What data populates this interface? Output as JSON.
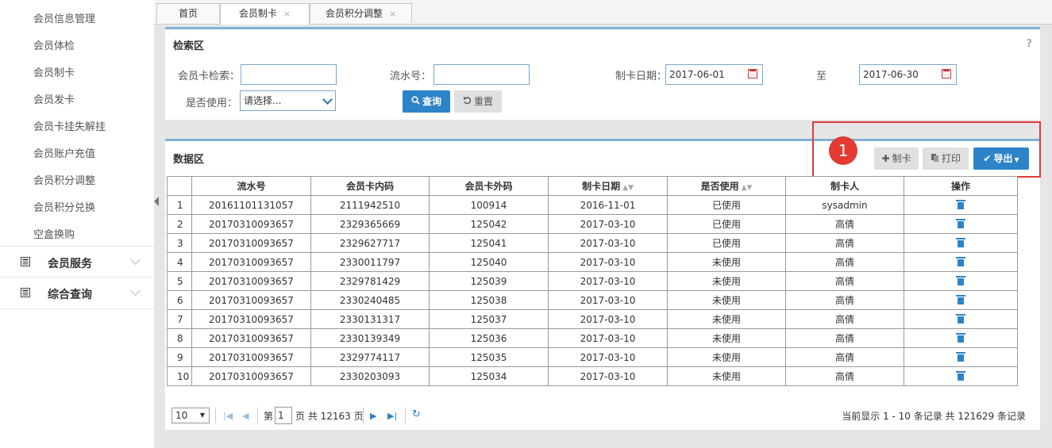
{
  "sidebar": {
    "items": [
      "会员信息管理",
      "会员体检",
      "会员制卡",
      "会员发卡",
      "会员卡挂失解挂",
      "会员账户充值",
      "会员积分调整",
      "会员积分兑换",
      "空盒换购"
    ],
    "groups": [
      {
        "label": "会员服务",
        "icon": "module-icon"
      },
      {
        "label": "综合查询",
        "icon": "module-icon"
      }
    ]
  },
  "tabs": [
    {
      "label": "首页",
      "closable": false
    },
    {
      "label": "会员制卡",
      "closable": true,
      "close": "×"
    },
    {
      "label": "会员积分调整",
      "closable": true,
      "close": "×"
    }
  ],
  "search": {
    "title": "检索区",
    "help": "?",
    "card_label": "会员卡检索：",
    "card_value": "",
    "serial_label": "流水号：",
    "serial_value": "",
    "date_label": "制卡日期：",
    "date_from": "2017-06-01",
    "to_label": "至",
    "date_to": "2017-06-30",
    "used_label": "是否使用：",
    "used_value": "请选择...",
    "query_button": "查询",
    "reset_button": "重置"
  },
  "data_area": {
    "title": "数据区",
    "add_button": "制卡",
    "print_button": "打印",
    "export_button": "导出",
    "marker": "1"
  },
  "table": {
    "headers": [
      "",
      "流水号",
      "会员卡内码",
      "会员卡外码",
      "制卡日期",
      "是否使用",
      "制卡人",
      "操作"
    ],
    "rows": [
      [
        "1",
        "20161101131057",
        "2111942510",
        "100914",
        "2016-11-01",
        "已使用",
        "sysadmin"
      ],
      [
        "2",
        "20170310093657",
        "2329365669",
        "125042",
        "2017-03-10",
        "已使用",
        "高倩"
      ],
      [
        "3",
        "20170310093657",
        "2329627717",
        "125041",
        "2017-03-10",
        "已使用",
        "高倩"
      ],
      [
        "4",
        "20170310093657",
        "2330011797",
        "125040",
        "2017-03-10",
        "未使用",
        "高倩"
      ],
      [
        "5",
        "20170310093657",
        "2329781429",
        "125039",
        "2017-03-10",
        "未使用",
        "高倩"
      ],
      [
        "6",
        "20170310093657",
        "2330240485",
        "125038",
        "2017-03-10",
        "未使用",
        "高倩"
      ],
      [
        "7",
        "20170310093657",
        "2330131317",
        "125037",
        "2017-03-10",
        "未使用",
        "高倩"
      ],
      [
        "8",
        "20170310093657",
        "2330139349",
        "125036",
        "2017-03-10",
        "未使用",
        "高倩"
      ],
      [
        "9",
        "20170310093657",
        "2329774117",
        "125035",
        "2017-03-10",
        "未使用",
        "高倩"
      ],
      [
        "10",
        "20170310093657",
        "2330203093",
        "125034",
        "2017-03-10",
        "未使用",
        "高倩"
      ]
    ]
  },
  "pager": {
    "page_size": "10",
    "page_prefix": "第",
    "page_value": "1",
    "page_suffix": "页 共 12163 页",
    "summary": "当前显示 1 - 10 条记录 共 121629 条记录"
  },
  "colors": {
    "accent": "#2d83c8",
    "highlight": "#e03a3a",
    "panel_border": "#7fb1d5"
  }
}
